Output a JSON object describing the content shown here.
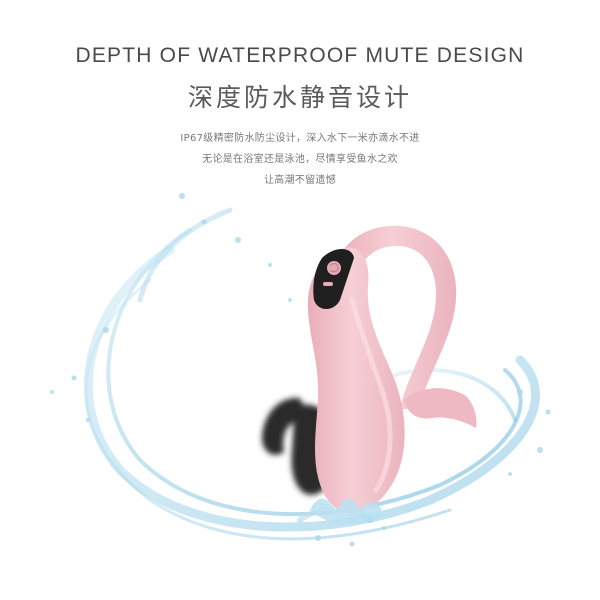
{
  "heading": {
    "en": "DEPTH OF WATERPROOF MUTE DESIGN",
    "cn": "深度防水静音设计"
  },
  "description": {
    "line1": "IP67级精密防水防尘设计，深入水下一米亦滴水不进",
    "line2": "无论是在浴室还是泳池，尽情享受鱼水之欢",
    "line3": "让高潮不留遗憾"
  },
  "colors": {
    "background": "#ffffff",
    "product_pink": "#f4c3cb",
    "product_dark": "#2a2a2a",
    "water": "#9fd3ea"
  },
  "icons": {
    "button": "rose-icon"
  }
}
